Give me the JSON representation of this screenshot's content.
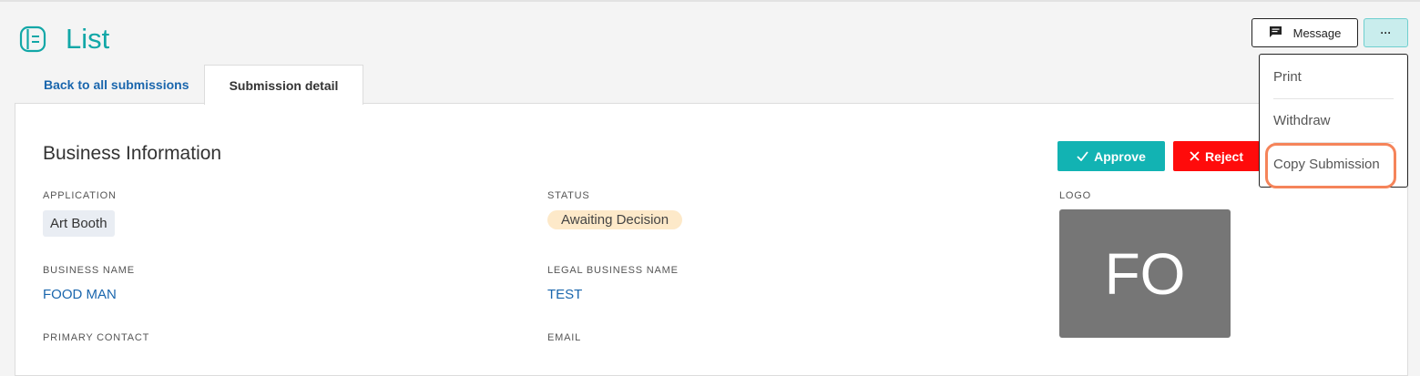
{
  "header": {
    "title": "List"
  },
  "actions": {
    "message_label": "Message",
    "more_label": "···"
  },
  "tabs": {
    "back": "Back to all submissions",
    "active": "Submission detail"
  },
  "section": {
    "title": "Business Information"
  },
  "buttons": {
    "approve": "Approve",
    "reject": "Reject"
  },
  "fields": {
    "application": {
      "label": "APPLICATION",
      "value": "Art Booth"
    },
    "status": {
      "label": "STATUS",
      "value": "Awaiting Decision"
    },
    "logo": {
      "label": "LOGO",
      "initials": "FO"
    },
    "business_name": {
      "label": "BUSINESS NAME",
      "value": "FOOD MAN"
    },
    "legal_business_name": {
      "label": "LEGAL BUSINESS NAME",
      "value": "TEST"
    },
    "primary_contact": {
      "label": "PRIMARY CONTACT"
    },
    "email": {
      "label": "EMAIL"
    }
  },
  "menu": {
    "items": [
      "Print",
      "Withdraw",
      "Copy Submission"
    ]
  },
  "colors": {
    "accent": "#12b3b3",
    "reject": "#ff0b0b",
    "link": "#1a66ad",
    "highlight": "#f5845a"
  },
  "icons": [
    "list-icon",
    "message-icon",
    "checkmark-icon",
    "close-icon"
  ]
}
